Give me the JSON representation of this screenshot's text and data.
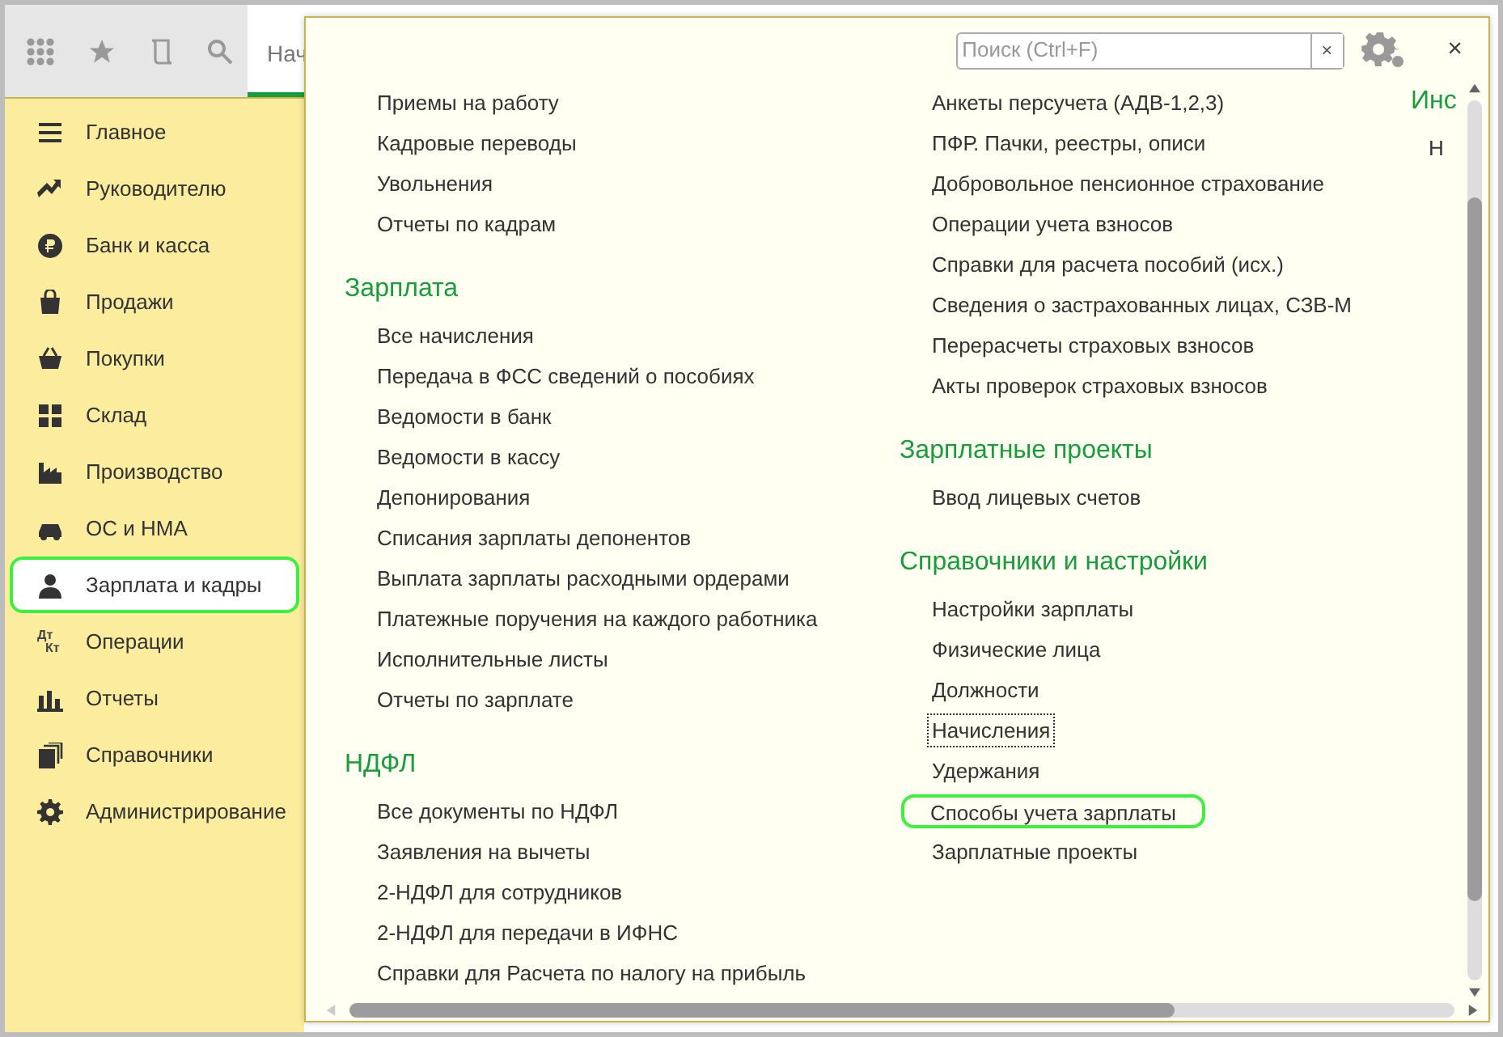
{
  "toolbar": {
    "tab": {
      "label": "Нач",
      "selected": true
    }
  },
  "sidebar": {
    "items": [
      {
        "label": "Главное",
        "selected": false
      },
      {
        "label": "Руководителю",
        "selected": false
      },
      {
        "label": "Банк и касса",
        "selected": false
      },
      {
        "label": "Продажи",
        "selected": false
      },
      {
        "label": "Покупки",
        "selected": false
      },
      {
        "label": "Склад",
        "selected": false
      },
      {
        "label": "Производство",
        "selected": false
      },
      {
        "label": "ОС и НМА",
        "selected": false
      },
      {
        "label": "Зарплата и кадры",
        "selected": true
      },
      {
        "label": "Операции",
        "selected": false,
        "icon_text": [
          "Дт",
          "Кт"
        ]
      },
      {
        "label": "Отчеты",
        "selected": false
      },
      {
        "label": "Справочники",
        "selected": false
      },
      {
        "label": "Администрирование",
        "selected": false
      }
    ]
  },
  "panel": {
    "search": {
      "placeholder": "Поиск (Ctrl+F)",
      "clear": "×"
    },
    "close": "×",
    "columns": [
      [
        {
          "items": [
            {
              "label": "Приемы на работу",
              "highlighted": false,
              "focused": false
            },
            {
              "label": "Кадровые переводы",
              "highlighted": false,
              "focused": false
            },
            {
              "label": "Увольнения",
              "highlighted": false,
              "focused": false
            },
            {
              "label": "Отчеты по кадрам",
              "highlighted": false,
              "focused": false
            }
          ]
        },
        {
          "heading": "Зарплата",
          "items": [
            {
              "label": "Все начисления",
              "highlighted": false,
              "focused": false
            },
            {
              "label": "Передача в ФСС сведений о пособиях",
              "highlighted": false,
              "focused": false
            },
            {
              "label": "Ведомости в банк",
              "highlighted": false,
              "focused": false
            },
            {
              "label": "Ведомости в кассу",
              "highlighted": false,
              "focused": false
            },
            {
              "label": "Депонирования",
              "highlighted": false,
              "focused": false
            },
            {
              "label": "Списания зарплаты депонентов",
              "highlighted": false,
              "focused": false
            },
            {
              "label": "Выплата зарплаты расходными ордерами",
              "highlighted": false,
              "focused": false
            },
            {
              "label": "Платежные поручения на каждого работника",
              "highlighted": false,
              "focused": false
            },
            {
              "label": "Исполнительные листы",
              "highlighted": false,
              "focused": false
            },
            {
              "label": "Отчеты по зарплате",
              "highlighted": false,
              "focused": false
            }
          ]
        },
        {
          "heading": "НДФЛ",
          "items": [
            {
              "label": "Все документы по НДФЛ",
              "highlighted": false,
              "focused": false
            },
            {
              "label": "Заявления на вычеты",
              "highlighted": false,
              "focused": false
            },
            {
              "label": "2-НДФЛ для сотрудников",
              "highlighted": false,
              "focused": false
            },
            {
              "label": "2-НДФЛ для передачи в ИФНС",
              "highlighted": false,
              "focused": false
            },
            {
              "label": "Справки для Расчета по налогу на прибыль",
              "highlighted": false,
              "focused": false
            }
          ]
        }
      ],
      [
        {
          "items": [
            {
              "label": "Анкеты персучета (АДВ-1,2,3)",
              "highlighted": false,
              "focused": false
            },
            {
              "label": "ПФР. Пачки, реестры, описи",
              "highlighted": false,
              "focused": false
            },
            {
              "label": "Добровольное пенсионное страхование",
              "highlighted": false,
              "focused": false
            },
            {
              "label": "Операции учета взносов",
              "highlighted": false,
              "focused": false
            },
            {
              "label": "Справки для расчета пособий (исх.)",
              "highlighted": false,
              "focused": false
            },
            {
              "label": "Сведения о застрахованных лицах, СЗВ-М",
              "highlighted": false,
              "focused": false
            },
            {
              "label": "Перерасчеты страховых взносов",
              "highlighted": false,
              "focused": false
            },
            {
              "label": "Акты проверок страховых взносов",
              "highlighted": false,
              "focused": false
            }
          ]
        },
        {
          "heading": "Зарплатные проекты",
          "items": [
            {
              "label": "Ввод лицевых счетов",
              "highlighted": false,
              "focused": false
            }
          ]
        },
        {
          "heading": "Справочники и настройки",
          "items": [
            {
              "label": "Настройки зарплаты",
              "highlighted": false,
              "focused": false
            },
            {
              "label": "Физические лица",
              "highlighted": false,
              "focused": false
            },
            {
              "label": "Должности",
              "highlighted": false,
              "focused": false
            },
            {
              "label": "Начисления",
              "highlighted": false,
              "focused": true
            },
            {
              "label": "Удержания",
              "highlighted": false,
              "focused": false
            },
            {
              "label": "Способы учета зарплаты",
              "highlighted": true,
              "focused": false
            },
            {
              "label": "Зарплатные проекты",
              "highlighted": false,
              "focused": false
            }
          ]
        }
      ],
      [
        {
          "heading": "Инс",
          "items": [
            {
              "label": "Н",
              "highlighted": false,
              "focused": false
            }
          ]
        }
      ]
    ]
  }
}
